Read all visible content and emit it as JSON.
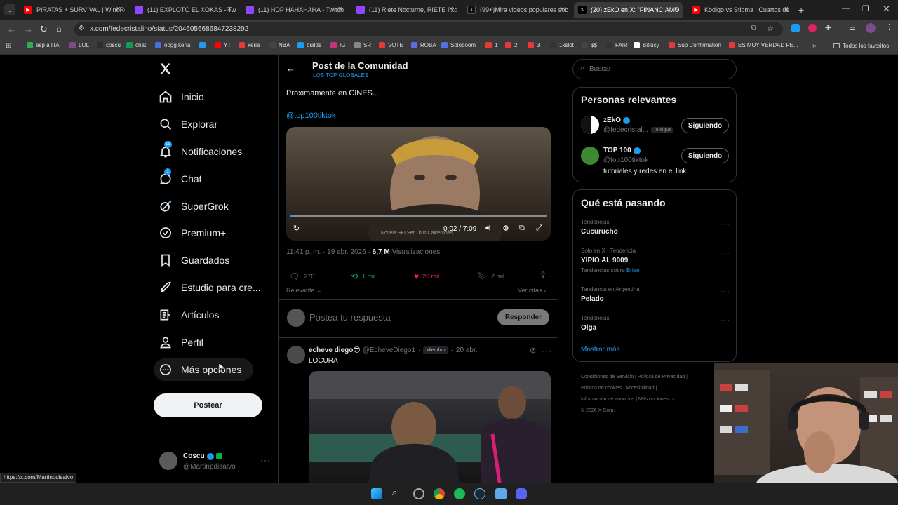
{
  "browser": {
    "tabs": [
      {
        "title": "PIRATAS + SURVIVAL | WindRo",
        "color": "#ff0000"
      },
      {
        "title": "(11) EXPLOTÓ EL XOKAS - Twitc",
        "color": "#9146ff"
      },
      {
        "title": "(11) HDP HAHAHAHA - Twitch",
        "color": "#9146ff"
      },
      {
        "title": "(11) Riete Nocturne, RIETE ! xd",
        "color": "#9146ff"
      },
      {
        "title": "(99+)Mira videos populares sob",
        "color": "#111111"
      },
      {
        "title": "(20) zEkO en X: \"FINANCIAMO",
        "color": "#000000"
      },
      {
        "title": "Kodigo vs Stigma | Cuartos de",
        "color": "#ff0000"
      }
    ],
    "url": "x.com/fedecristalino/status/2046056686847238292",
    "bookmarks": [
      "esp a ITA",
      "LOL",
      "coscu",
      "chat",
      "opgg keria",
      "",
      "YT",
      "keria",
      "NBA",
      "builds",
      "IG",
      "SR",
      "VOTE",
      "ROBA",
      "Soloboom",
      "1",
      "2",
      "3",
      "1xslot",
      "$$",
      "FAIR",
      "Bitlucy",
      "Sub Confirmation",
      "ES MUY VERDAD PE..."
    ],
    "all_favorites": "Todos los favoritos",
    "status_url": "https://x.com/Martinpdisalvo"
  },
  "sidebar": {
    "items": [
      {
        "label": "Inicio",
        "icon": "home-icon"
      },
      {
        "label": "Explorar",
        "icon": "search-icon"
      },
      {
        "label": "Notificaciones",
        "icon": "bell-icon",
        "badge": "19"
      },
      {
        "label": "Chat",
        "icon": "chat-icon",
        "badge": "1"
      },
      {
        "label": "SuperGrok",
        "icon": "grok-icon"
      },
      {
        "label": "Premium+",
        "icon": "verified-icon"
      },
      {
        "label": "Guardados",
        "icon": "bookmark-icon"
      },
      {
        "label": "Estudio para cre...",
        "icon": "rocket-icon"
      },
      {
        "label": "Artículos",
        "icon": "article-icon"
      },
      {
        "label": "Perfil",
        "icon": "person-icon"
      },
      {
        "label": "Más opciones",
        "icon": "more-icon"
      }
    ],
    "post_button": "Postear",
    "account": {
      "name": "Coscu",
      "handle": "@Martinpdisalvo"
    }
  },
  "post": {
    "header_title": "Post de la Comunidad",
    "community": "LOS TOP GLOBALES",
    "text": "Proximamente en CINES...",
    "mention": "@top100tiktok",
    "video": {
      "time": "0:02 / 7:09",
      "watermark": "Novela SEI Ser Titus Calderonas"
    },
    "timestamp": "11:41 p. m. · 19 abr. 2026 · ",
    "views_count": "6,7 M",
    "views_label": " Visualizaciones",
    "stats": {
      "replies": "270",
      "reposts": "1 mil",
      "likes": "20 mil",
      "bookmarks": "2 mil"
    },
    "sort_label": "Relevante",
    "quotes_label": "Ver citas",
    "reply_placeholder": "Postea tu respuesta",
    "reply_button": "Responder"
  },
  "reply": {
    "name": "echeve diego😎",
    "handle": "@EcheveDiego1",
    "badge": "Miembro",
    "date": "20 abr.",
    "text": "LOCURA"
  },
  "right": {
    "search_placeholder": "Buscar",
    "relevant_title": "Personas relevantes",
    "people": [
      {
        "name": "zEkO",
        "handle": "@fedecristal...",
        "follows_you": "Te sigue",
        "button": "Siguiendo"
      },
      {
        "name": "TOP 100",
        "handle": "@top100tiktok",
        "bio": "tutoriales y redes en el link",
        "button": "Siguiendo"
      }
    ],
    "trends_title": "Qué está pasando",
    "trends": [
      {
        "context": "Tendencias",
        "name": "Cucurucho"
      },
      {
        "context": "Solo en X · Tendencia",
        "name": "YIPIO AL 9009",
        "extra_prefix": "Tendencias sobre ",
        "extra_link": "Brian"
      },
      {
        "context": "Tendencia en Argentina",
        "name": "Pelado"
      },
      {
        "context": "Tendencias",
        "name": "Olga"
      }
    ],
    "show_more": "Mostrar más",
    "footer": [
      "Condiciones de Servicio",
      "Política de Privacidad",
      "Política de cookies",
      "Accesibilidad",
      "Información de anuncios",
      "Más opciones ···",
      "© 2026 X Corp."
    ]
  }
}
